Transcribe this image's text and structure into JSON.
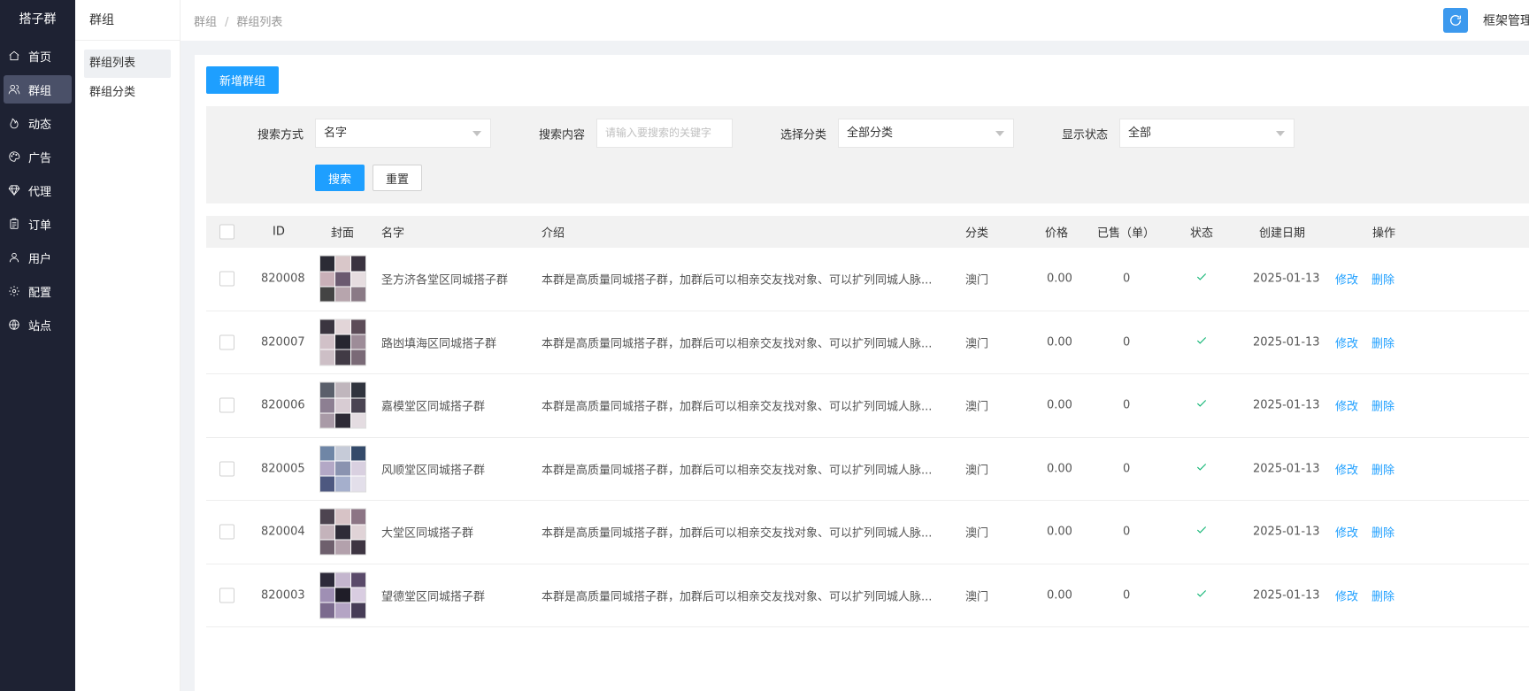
{
  "brand": "搭子群",
  "nav": [
    {
      "label": "首页",
      "icon": "home-icon",
      "active": false
    },
    {
      "label": "群组",
      "icon": "users-icon",
      "active": true
    },
    {
      "label": "动态",
      "icon": "fire-icon",
      "active": false
    },
    {
      "label": "广告",
      "icon": "palette-icon",
      "active": false
    },
    {
      "label": "代理",
      "icon": "diamond-icon",
      "active": false
    },
    {
      "label": "订单",
      "icon": "clipboard-icon",
      "active": false
    },
    {
      "label": "用户",
      "icon": "user-icon",
      "active": false
    },
    {
      "label": "配置",
      "icon": "gear-icon",
      "active": false
    },
    {
      "label": "站点",
      "icon": "globe-icon",
      "active": false
    }
  ],
  "subnav": {
    "title": "群组",
    "items": [
      {
        "label": "群组列表",
        "active": true
      },
      {
        "label": "群组分类",
        "active": false
      }
    ]
  },
  "breadcrumb": {
    "root": "群组",
    "separator": "/",
    "current": "群组列表"
  },
  "header": {
    "manage_label": "框架管理"
  },
  "toolbar": {
    "add_label": "新增群组"
  },
  "search": {
    "method_label": "搜索方式",
    "method_value": "名字",
    "content_label": "搜索内容",
    "content_placeholder": "请输入要搜索的关键字",
    "category_label": "选择分类",
    "category_value": "全部分类",
    "status_label": "显示状态",
    "status_value": "全部",
    "search_btn": "搜索",
    "reset_btn": "重置"
  },
  "table": {
    "headers": {
      "id": "ID",
      "cover": "封面",
      "name": "名字",
      "intro": "介绍",
      "category": "分类",
      "price": "价格",
      "sold": "已售（单）",
      "status": "状态",
      "created": "创建日期",
      "actions": "操作"
    },
    "edit_label": "修改",
    "delete_label": "删除",
    "rows": [
      {
        "id": "820008",
        "name": "圣方济各堂区同城搭子群",
        "intro": "本群是高质量同城搭子群，加群后可以相亲交友找对象、可以扩列同城人脉...",
        "category": "澳门",
        "price": "0.00",
        "sold": "0",
        "created": "2025-01-13"
      },
      {
        "id": "820007",
        "name": "路凼填海区同城搭子群",
        "intro": "本群是高质量同城搭子群，加群后可以相亲交友找对象、可以扩列同城人脉...",
        "category": "澳门",
        "price": "0.00",
        "sold": "0",
        "created": "2025-01-13"
      },
      {
        "id": "820006",
        "name": "嘉模堂区同城搭子群",
        "intro": "本群是高质量同城搭子群，加群后可以相亲交友找对象、可以扩列同城人脉...",
        "category": "澳门",
        "price": "0.00",
        "sold": "0",
        "created": "2025-01-13"
      },
      {
        "id": "820005",
        "name": "风顺堂区同城搭子群",
        "intro": "本群是高质量同城搭子群，加群后可以相亲交友找对象、可以扩列同城人脉...",
        "category": "澳门",
        "price": "0.00",
        "sold": "0",
        "created": "2025-01-13"
      },
      {
        "id": "820004",
        "name": "大堂区同城搭子群",
        "intro": "本群是高质量同城搭子群，加群后可以相亲交友找对象、可以扩列同城人脉...",
        "category": "澳门",
        "price": "0.00",
        "sold": "0",
        "created": "2025-01-13"
      },
      {
        "id": "820003",
        "name": "望德堂区同城搭子群",
        "intro": "本群是高质量同城搭子群，加群后可以相亲交友找对象、可以扩列同城人脉...",
        "category": "澳门",
        "price": "0.00",
        "sold": "0",
        "created": "2025-01-13"
      }
    ]
  },
  "colors": {
    "primary": "#1e9fff",
    "sidebar_bg": "#1e2233",
    "sidebar_active": "#4a5068",
    "success": "#16b777"
  }
}
